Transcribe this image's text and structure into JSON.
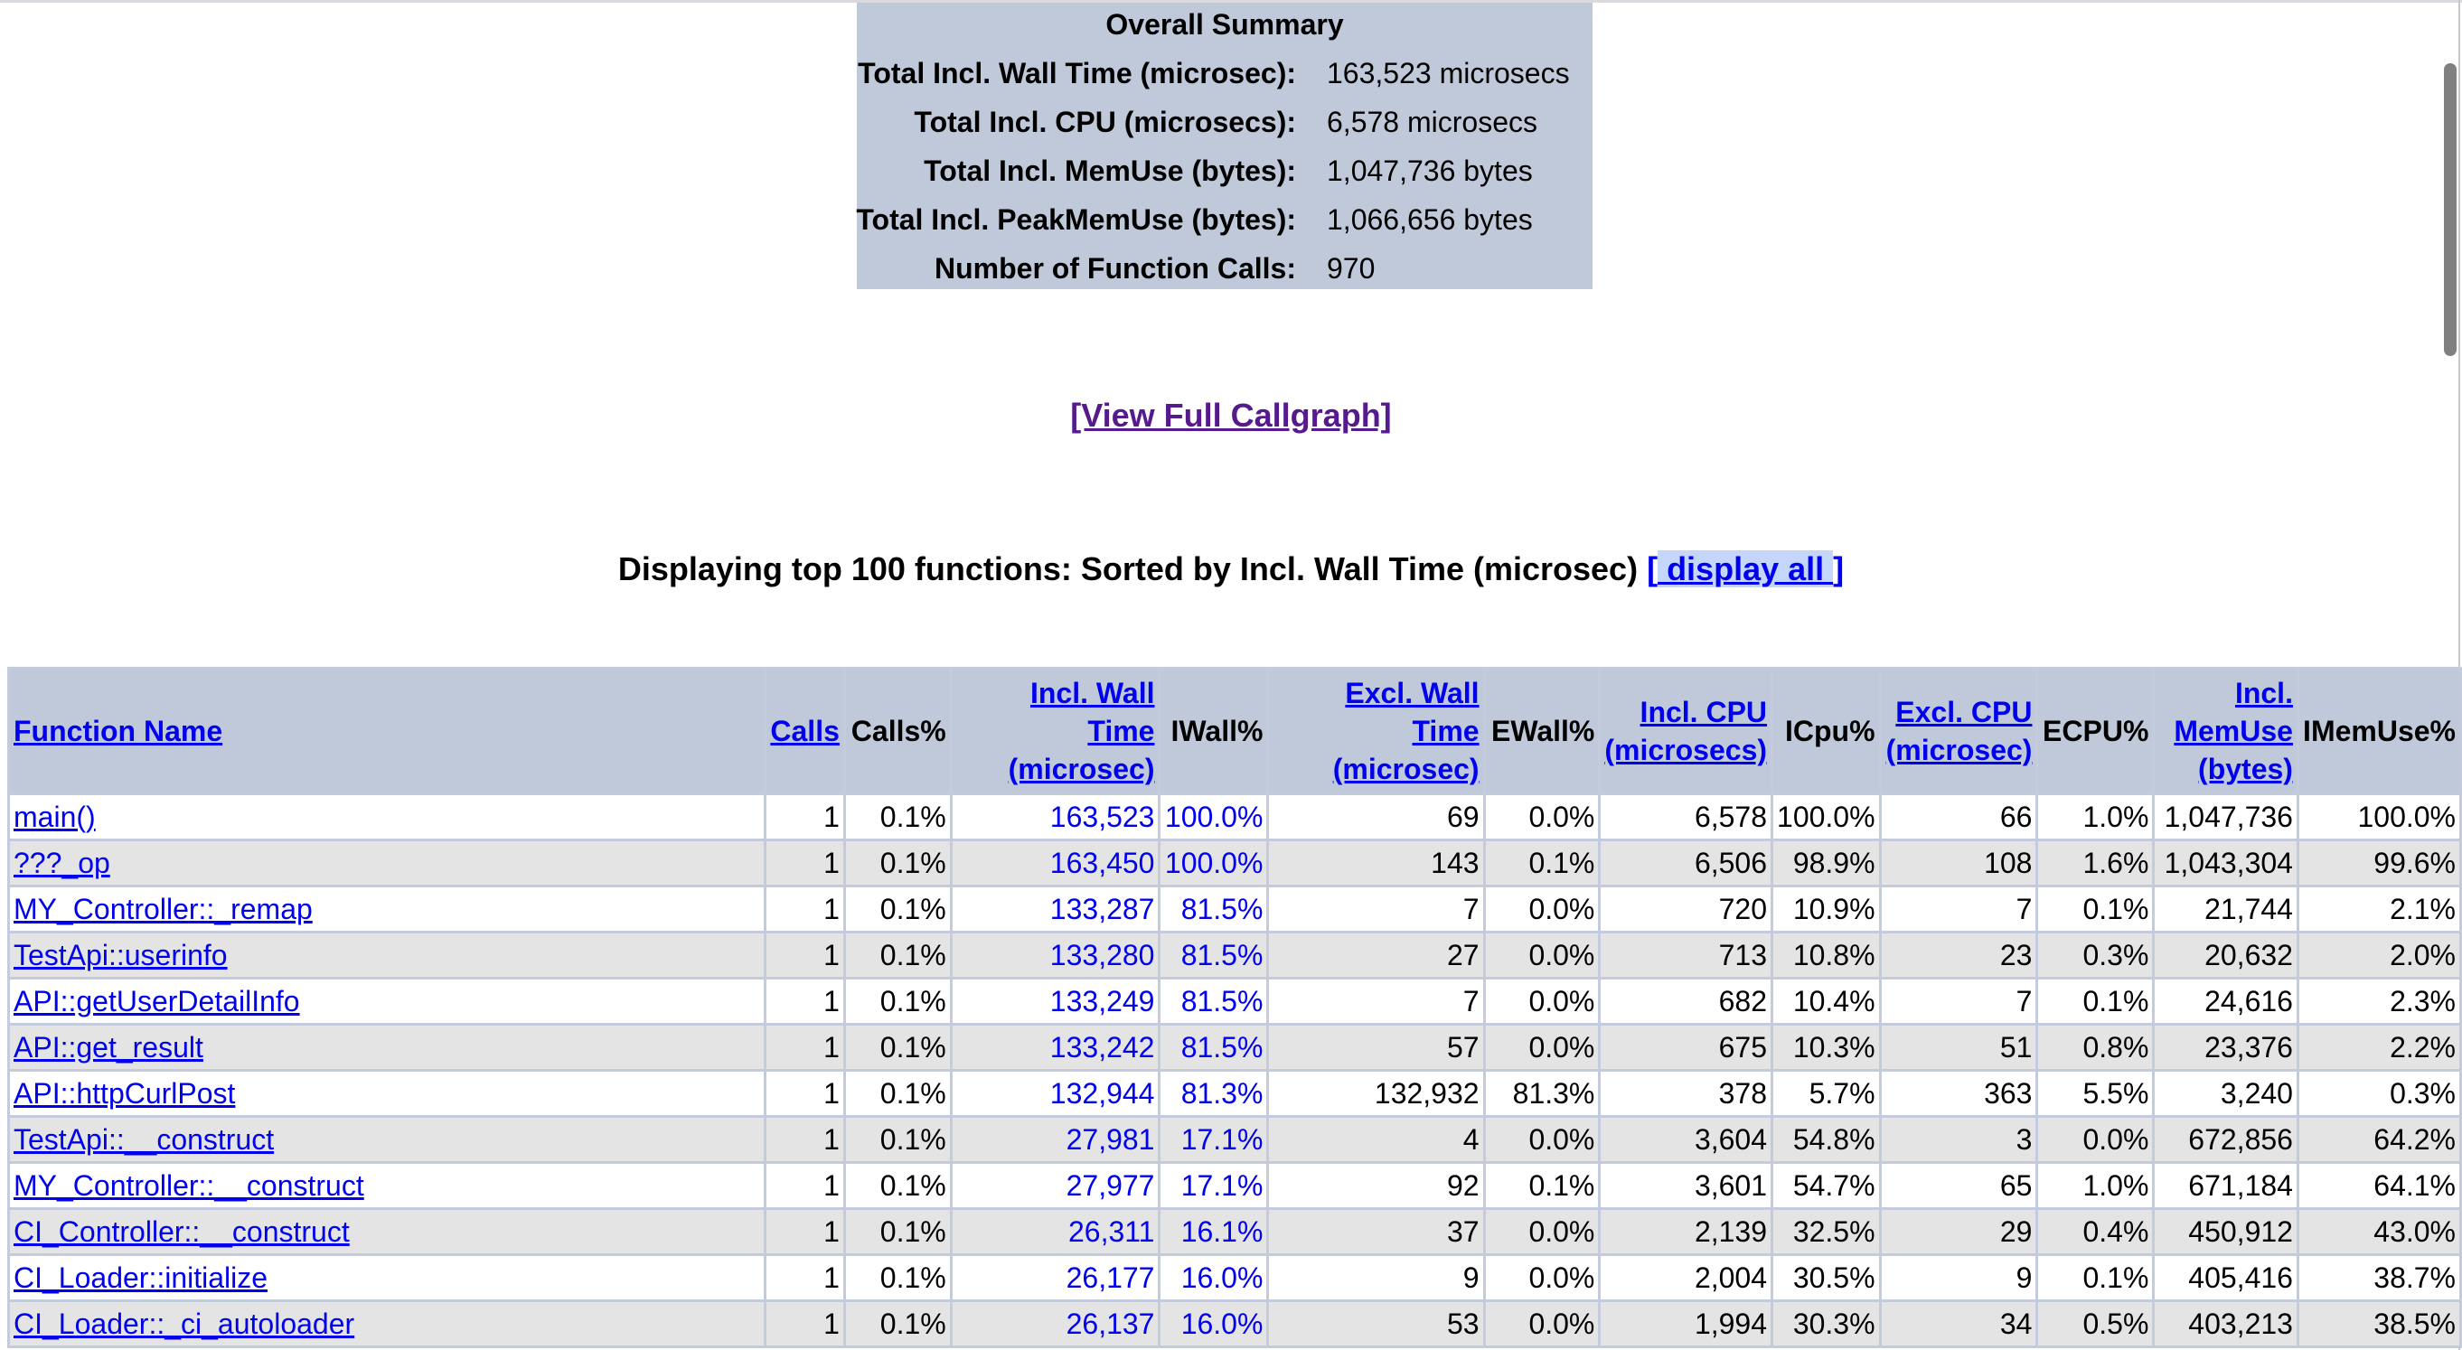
{
  "summary": {
    "title": "Overall Summary",
    "rows": [
      {
        "label": "Total Incl. Wall Time (microsec):",
        "value": "163,523 microsecs"
      },
      {
        "label": "Total Incl. CPU (microsecs):",
        "value": "6,578 microsecs"
      },
      {
        "label": "Total Incl. MemUse (bytes):",
        "value": "1,047,736 bytes"
      },
      {
        "label": "Total Incl. PeakMemUse (bytes):",
        "value": "1,066,656 bytes"
      },
      {
        "label": "Number of Function Calls:",
        "value": "970"
      }
    ]
  },
  "callgraph_link": "[View Full Callgraph]",
  "display": {
    "text": "Displaying top 100 functions: Sorted by Incl. Wall Time (microsec) ",
    "link_open": "[",
    "link_label": " display all ",
    "link_close": "]"
  },
  "table": {
    "headers": [
      {
        "label": "Function Name",
        "link": true
      },
      {
        "label": "Calls",
        "link": true
      },
      {
        "label": "Calls%",
        "link": false
      },
      {
        "label": "Incl. Wall Time (microsec)",
        "link": true
      },
      {
        "label": "IWall%",
        "link": false
      },
      {
        "label": "Excl. Wall Time (microsec)",
        "link": true
      },
      {
        "label": "EWall%",
        "link": false
      },
      {
        "label": "Incl. CPU (microsecs)",
        "link": true
      },
      {
        "label": "ICpu%",
        "link": false
      },
      {
        "label": "Excl. CPU (microsec)",
        "link": true
      },
      {
        "label": "ECPU%",
        "link": false
      },
      {
        "label": "Incl. MemUse (bytes)",
        "link": true
      },
      {
        "label": "IMemUse%",
        "link": false
      }
    ],
    "rows": [
      [
        "main()",
        "1",
        "0.1%",
        "163,523",
        "100.0%",
        "69",
        "0.0%",
        "6,578",
        "100.0%",
        "66",
        "1.0%",
        "1,047,736",
        "100.0%"
      ],
      [
        "???_op",
        "1",
        "0.1%",
        "163,450",
        "100.0%",
        "143",
        "0.1%",
        "6,506",
        "98.9%",
        "108",
        "1.6%",
        "1,043,304",
        "99.6%"
      ],
      [
        "MY_Controller::_remap",
        "1",
        "0.1%",
        "133,287",
        "81.5%",
        "7",
        "0.0%",
        "720",
        "10.9%",
        "7",
        "0.1%",
        "21,744",
        "2.1%"
      ],
      [
        "TestApi::userinfo",
        "1",
        "0.1%",
        "133,280",
        "81.5%",
        "27",
        "0.0%",
        "713",
        "10.8%",
        "23",
        "0.3%",
        "20,632",
        "2.0%"
      ],
      [
        "API::getUserDetailInfo",
        "1",
        "0.1%",
        "133,249",
        "81.5%",
        "7",
        "0.0%",
        "682",
        "10.4%",
        "7",
        "0.1%",
        "24,616",
        "2.3%"
      ],
      [
        "API::get_result",
        "1",
        "0.1%",
        "133,242",
        "81.5%",
        "57",
        "0.0%",
        "675",
        "10.3%",
        "51",
        "0.8%",
        "23,376",
        "2.2%"
      ],
      [
        "API::httpCurlPost",
        "1",
        "0.1%",
        "132,944",
        "81.3%",
        "132,932",
        "81.3%",
        "378",
        "5.7%",
        "363",
        "5.5%",
        "3,240",
        "0.3%"
      ],
      [
        "TestApi::__construct",
        "1",
        "0.1%",
        "27,981",
        "17.1%",
        "4",
        "0.0%",
        "3,604",
        "54.8%",
        "3",
        "0.0%",
        "672,856",
        "64.2%"
      ],
      [
        "MY_Controller::__construct",
        "1",
        "0.1%",
        "27,977",
        "17.1%",
        "92",
        "0.1%",
        "3,601",
        "54.7%",
        "65",
        "1.0%",
        "671,184",
        "64.1%"
      ],
      [
        "CI_Controller::__construct",
        "1",
        "0.1%",
        "26,311",
        "16.1%",
        "37",
        "0.0%",
        "2,139",
        "32.5%",
        "29",
        "0.4%",
        "450,912",
        "43.0%"
      ],
      [
        "CI_Loader::initialize",
        "1",
        "0.1%",
        "26,177",
        "16.0%",
        "9",
        "0.0%",
        "2,004",
        "30.5%",
        "9",
        "0.1%",
        "405,416",
        "38.7%"
      ],
      [
        "CI_Loader::_ci_autoloader",
        "1",
        "0.1%",
        "26,137",
        "16.0%",
        "53",
        "0.0%",
        "1,994",
        "30.3%",
        "34",
        "0.5%",
        "403,213",
        "38.5%"
      ]
    ]
  }
}
